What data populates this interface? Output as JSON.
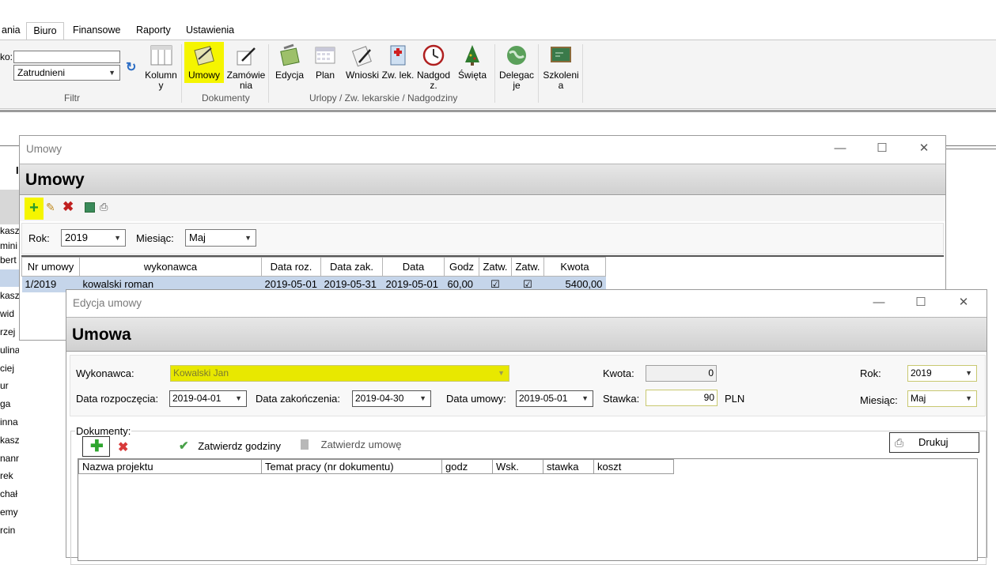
{
  "ribbon": {
    "tabs": [
      "ania",
      "Biuro",
      "Finansowe",
      "Raporty",
      "Ustawienia"
    ],
    "active_tab": "Biuro",
    "filter": {
      "label": "ko:",
      "search_value": "",
      "status_select": "Zatrudnieni",
      "group_label": "Filtr"
    },
    "buttons": {
      "kolumny": "Kolumn y",
      "umowy": "Umowy",
      "zamowienia": "Zamówie nia",
      "edycja": "Edycja",
      "plan": "Plan",
      "wnioski": "Wnioski",
      "zw_lek": "Zw. lek.",
      "nadgodziny": "Nadgod z.",
      "swieta": "Święta",
      "delegacje": "Delegac je",
      "szkolenia": "Szkoleni a"
    },
    "groups": {
      "dokumenty": "Dokumenty",
      "urlopy": "Urlopy / Zw. lekarskie / Nadgodziny"
    }
  },
  "bg_list": [
    "kasz",
    "mini",
    "bert",
    "",
    "kasz",
    "wid",
    "rzej",
    "ulina",
    "ciej",
    "ur",
    "ga",
    "inna",
    "kasz",
    "nann",
    "rek",
    "chał",
    "emy",
    "rcin"
  ],
  "umowy_window": {
    "title": "Umowy",
    "banner": "Umowy",
    "rok_label": "Rok:",
    "rok_value": "2019",
    "miesiac_label": "Miesiąc:",
    "miesiac_value": "Maj",
    "columns": [
      "Nr umowy",
      "wykonawca",
      "Data roz.",
      "Data zak.",
      "Data",
      "Godz",
      "Zatw.",
      "Zatw.",
      "Kwota"
    ],
    "row": {
      "nr": "1/2019",
      "wykonawca": "kowalski roman",
      "data_roz": "2019-05-01",
      "data_zak": "2019-05-31",
      "data": "2019-05-01",
      "godz": "60,00",
      "zatw1": "☑",
      "zatw2": "☑",
      "kwota": "5400,00"
    }
  },
  "edycja_window": {
    "title": "Edycja umowy",
    "banner": "Umowa",
    "wykonawca_label": "Wykonawca:",
    "wykonawca_value": "Kowalski Jan",
    "kwota_label": "Kwota:",
    "kwota_value": "0",
    "rok_label": "Rok:",
    "rok_value": "2019",
    "data_rozp_label": "Data rozpoczęcia:",
    "data_rozp_value": "2019-04-01",
    "data_zak_label": "Data zakończenia:",
    "data_zak_value": "2019-04-30",
    "data_umowy_label": "Data umowy:",
    "data_umowy_value": "2019-05-01",
    "stawka_label": "Stawka:",
    "stawka_value": "90",
    "stawka_unit": "PLN",
    "miesiac_label": "Miesiąc:",
    "miesiac_value": "Maj",
    "dokumenty_label": "Dokumenty:",
    "zatwierdz_godziny": "Zatwierdz godziny",
    "zatwierdz_umowe": "Zatwierdz umowę",
    "drukuj": "Drukuj",
    "columns": [
      "Nazwa projektu",
      "Temat pracy (nr dokumentu)",
      "godz",
      "Wsk.",
      "stawka",
      "koszt"
    ]
  },
  "colors": {
    "highlight": "#f5f500",
    "banner": "#d7d7d7",
    "selected_row": "#c5d5ea"
  }
}
